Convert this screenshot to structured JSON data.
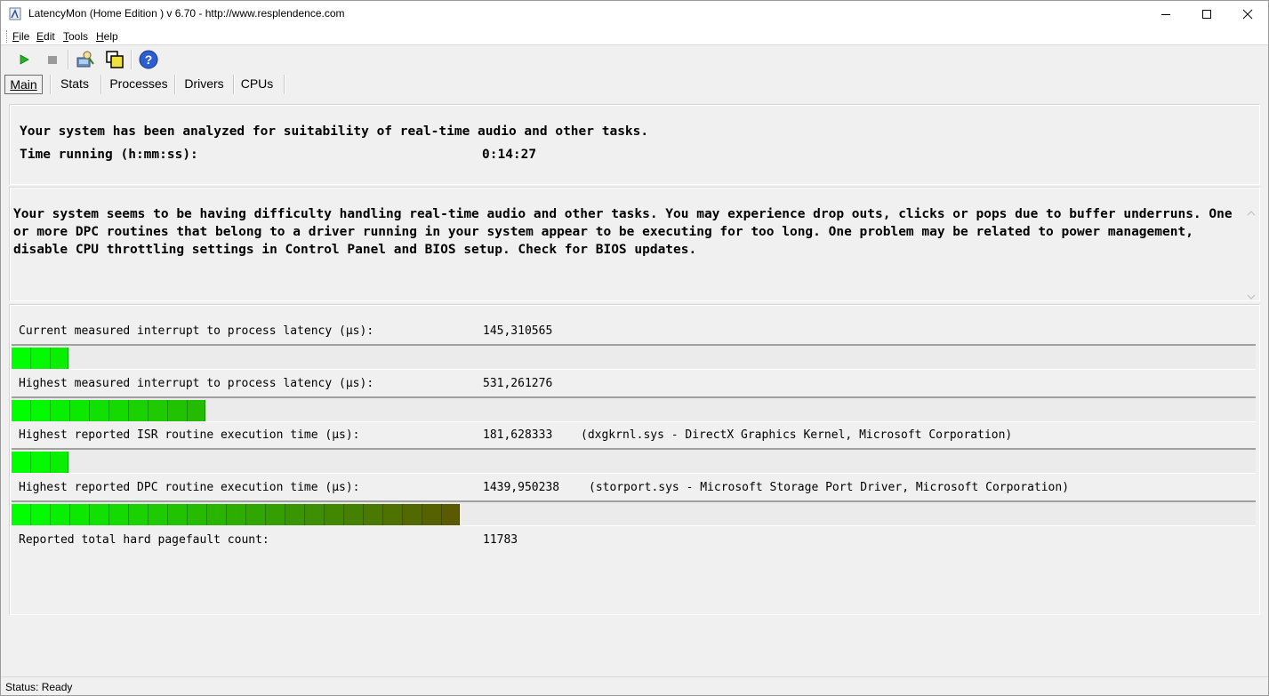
{
  "window": {
    "title": "LatencyMon  (Home Edition )  v 6.70 - http://www.resplendence.com"
  },
  "menu": [
    {
      "label": "File",
      "accel": "F",
      "rest": "ile"
    },
    {
      "label": "Edit",
      "accel": "E",
      "rest": "dit"
    },
    {
      "label": "Tools",
      "accel": "T",
      "rest": "ools"
    },
    {
      "label": "Help",
      "accel": "H",
      "rest": "elp"
    }
  ],
  "toolbar": {
    "icons": [
      "start-icon",
      "stop-icon",
      "driver-update-icon",
      "windows-icon",
      "help-icon"
    ]
  },
  "tabs": [
    {
      "label": "Main",
      "active": true
    },
    {
      "label": "Stats",
      "active": false
    },
    {
      "label": "Processes",
      "active": false
    },
    {
      "label": "Drivers",
      "active": false
    },
    {
      "label": "CPUs",
      "active": false
    }
  ],
  "summary": {
    "headline": "Your system has been analyzed for suitability of real-time audio and other tasks.",
    "time_label": "Time running (h:mm:ss):",
    "time_value": "0:14:27"
  },
  "warning": {
    "text": "Your system seems to be having difficulty handling real-time audio and other tasks. You may experience drop outs, clicks or pops due to buffer underruns. One or more DPC routines that belong to a driver running in your system appear to be executing for too long. One problem may be related to power management, disable CPU throttling settings in Control Panel and BIOS setup. Check for BIOS updates."
  },
  "metrics": [
    {
      "label": "Current measured interrupt to process latency (µs):",
      "value": "145,310565",
      "extra": "",
      "level_segments": 3
    },
    {
      "label": "Highest measured interrupt to process latency (µs):",
      "value": "531,261276",
      "extra": "",
      "level_segments": 10
    },
    {
      "label": "Highest reported ISR routine execution time (µs):",
      "value": "181,628333",
      "extra": "(dxgkrnl.sys - DirectX Graphics Kernel, Microsoft Corporation)",
      "level_segments": 3
    },
    {
      "label": "Highest reported DPC routine execution time (µs):",
      "value": "1439,950238",
      "extra": "(storport.sys - Microsoft Storage Port Driver, Microsoft Corporation)",
      "level_segments": 23
    }
  ],
  "pagefault": {
    "label": "Reported total hard pagefault count:",
    "value": "11783"
  },
  "status": {
    "text": "Status: Ready"
  },
  "colors": {
    "bar_start": "#00ff00",
    "bar_end": "#5a5a00"
  }
}
